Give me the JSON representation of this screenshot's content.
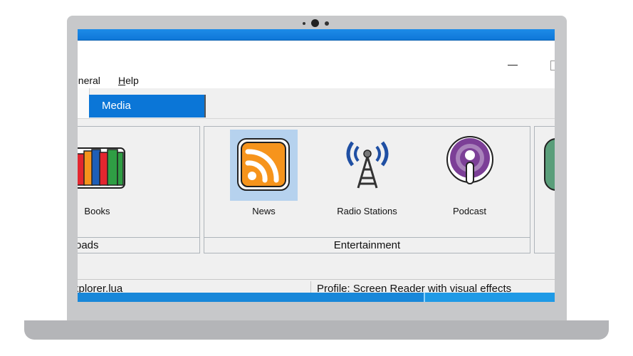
{
  "menu": {
    "items": [
      {
        "label": "eneral",
        "underline": ""
      },
      {
        "label": "Help",
        "underline": "H"
      }
    ]
  },
  "tabs": {
    "active_label": "Media"
  },
  "groups": [
    {
      "label": "oads",
      "tiles": [
        {
          "label": "Books",
          "icon": "books-icon"
        }
      ]
    },
    {
      "label": "Entertainment",
      "tiles": [
        {
          "label": "News",
          "icon": "rss-news-icon",
          "selected": true
        },
        {
          "label": "Radio Stations",
          "icon": "radio-tower-icon",
          "selected": false
        },
        {
          "label": "Podcast",
          "icon": "podcast-icon",
          "selected": false
        }
      ]
    }
  ],
  "status": {
    "left": "xplorer.lua",
    "right": "Profile: Screen Reader with visual effects"
  },
  "colors": {
    "accent": "#0b76d7",
    "selection": "#b6d2ee",
    "rss_orange": "#f6941c",
    "podcast_purple": "#7c3f97"
  }
}
